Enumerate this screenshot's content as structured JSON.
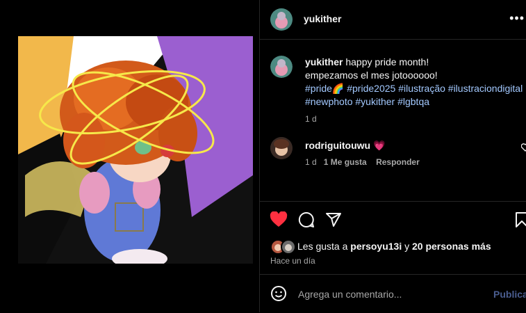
{
  "post": {
    "username": "yukither",
    "caption_line1": "happy pride month!",
    "caption_line2": "empezamos el mes jotoooooo!",
    "tags_line1": "#pride🌈 #pride2025 #ilustração #ilustraciondigital",
    "tags_line2": "#newphoto #yukither #lgbtqa",
    "caption_age": "1 d"
  },
  "comment": {
    "username": "rodriguitouwu",
    "text": "💗",
    "age": "1 d",
    "likes": "1 Me gusta",
    "reply": "Responder"
  },
  "likes": {
    "prefix": "Les gusta a",
    "user": "persoyu13i",
    "joiner": "y",
    "others": "20 personas más",
    "time": "Hace un día"
  },
  "composer": {
    "placeholder": "Agrega un comentario...",
    "post_label": "Publicar"
  },
  "colors": {
    "like_red": "#ff3040",
    "link_blue": "#a3c9ff",
    "divider": "#262626"
  },
  "icons": [
    "more-icon",
    "heart-icon",
    "comment-icon",
    "share-icon",
    "save-icon",
    "emoji-icon"
  ]
}
